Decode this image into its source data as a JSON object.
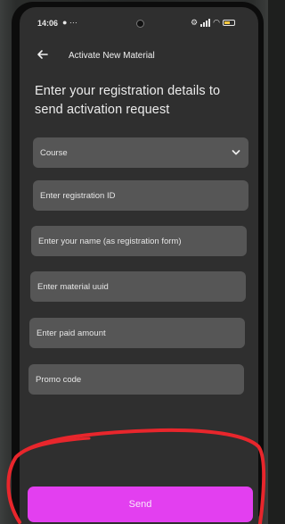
{
  "status_bar": {
    "time": "14:06",
    "extra": "● ···",
    "settings_glyph": "⚙",
    "wifi_glyph": "◠"
  },
  "header": {
    "title": "Activate New Material"
  },
  "headline": "Enter your registration details to send activation request",
  "form": {
    "course_label": "Course",
    "registration_id_placeholder": "Enter registration ID",
    "name_placeholder": "Enter your name (as registration form)",
    "material_uuid_placeholder": "Enter material uuid",
    "paid_amount_placeholder": "Enter paid amount",
    "promo_code_placeholder": "Promo code"
  },
  "send_label": "Send",
  "colors": {
    "screen_bg": "#2f2f2f",
    "field_bg": "#565656",
    "accent": "#e33ff0",
    "annotation": "#e8262c"
  },
  "icons": [
    "back-arrow-icon",
    "chevron-down-icon",
    "signal-icon",
    "wifi-icon",
    "battery-icon",
    "settings-icon",
    "camera-cutout"
  ]
}
